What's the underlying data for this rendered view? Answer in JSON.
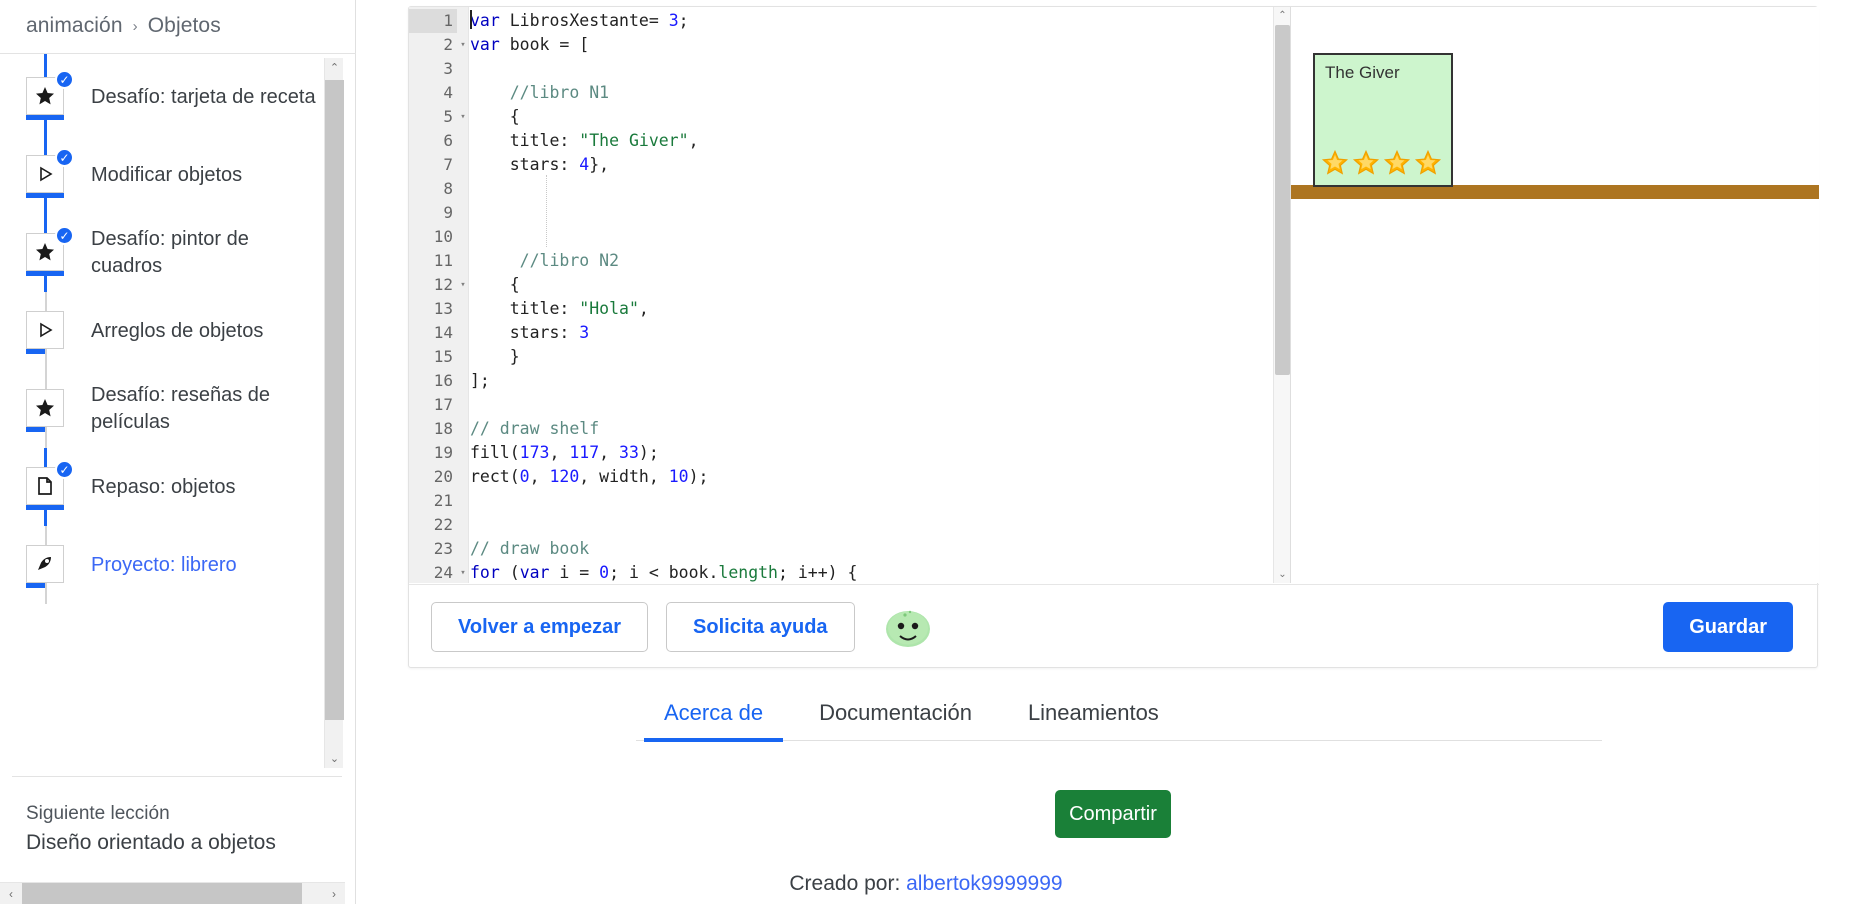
{
  "breadcrumb": {
    "parent": "animación",
    "separator": "›",
    "current": "Objetos"
  },
  "sidebar": {
    "items": [
      {
        "label": "Desafío: tarjeta de receta",
        "icon": "star-icon",
        "completed": true,
        "current": false
      },
      {
        "label": "Modificar objetos",
        "icon": "play-icon",
        "completed": true,
        "current": false
      },
      {
        "label": "Desafío: pintor de cuadros",
        "icon": "star-icon",
        "completed": true,
        "current": false
      },
      {
        "label": "Arreglos de objetos",
        "icon": "play-icon",
        "completed": false,
        "current": false
      },
      {
        "label": "Desafío: reseñas de películas",
        "icon": "star-icon",
        "completed": false,
        "current": false
      },
      {
        "label": "Repaso: objetos",
        "icon": "document-icon",
        "completed": true,
        "current": false
      },
      {
        "label": "Proyecto: librero",
        "icon": "rocket-icon",
        "completed": false,
        "current": true
      }
    ],
    "next_lesson_label": "Siguiente lección",
    "next_lesson_title": "Diseño orientado a objetos"
  },
  "editor": {
    "active_line": 1,
    "lines": [
      {
        "n": 1,
        "fold": false,
        "tokens": [
          {
            "t": "var",
            "c": "kw"
          },
          {
            "t": " LibrosXestante= ",
            "c": "pln"
          },
          {
            "t": "3",
            "c": "num"
          },
          {
            "t": ";",
            "c": "pln"
          }
        ]
      },
      {
        "n": 2,
        "fold": true,
        "tokens": [
          {
            "t": "var",
            "c": "kw"
          },
          {
            "t": " book = [",
            "c": "pln"
          }
        ]
      },
      {
        "n": 3,
        "fold": false,
        "tokens": []
      },
      {
        "n": 4,
        "fold": false,
        "tokens": [
          {
            "t": "    //libro N1",
            "c": "com"
          }
        ]
      },
      {
        "n": 5,
        "fold": true,
        "tokens": [
          {
            "t": "    {",
            "c": "pln"
          }
        ]
      },
      {
        "n": 6,
        "fold": false,
        "tokens": [
          {
            "t": "    title: ",
            "c": "pln"
          },
          {
            "t": "\"The Giver\"",
            "c": "str"
          },
          {
            "t": ",",
            "c": "pln"
          }
        ]
      },
      {
        "n": 7,
        "fold": false,
        "tokens": [
          {
            "t": "    stars: ",
            "c": "pln"
          },
          {
            "t": "4",
            "c": "num"
          },
          {
            "t": "},",
            "c": "pln"
          }
        ]
      },
      {
        "n": 8,
        "fold": false,
        "tokens": []
      },
      {
        "n": 9,
        "fold": false,
        "tokens": []
      },
      {
        "n": 10,
        "fold": false,
        "tokens": []
      },
      {
        "n": 11,
        "fold": false,
        "tokens": [
          {
            "t": "     //libro N2",
            "c": "com"
          }
        ]
      },
      {
        "n": 12,
        "fold": true,
        "tokens": [
          {
            "t": "    {",
            "c": "pln"
          }
        ]
      },
      {
        "n": 13,
        "fold": false,
        "tokens": [
          {
            "t": "    title: ",
            "c": "pln"
          },
          {
            "t": "\"Hola\"",
            "c": "str"
          },
          {
            "t": ",",
            "c": "pln"
          }
        ]
      },
      {
        "n": 14,
        "fold": false,
        "tokens": [
          {
            "t": "    stars: ",
            "c": "pln"
          },
          {
            "t": "3",
            "c": "num"
          }
        ]
      },
      {
        "n": 15,
        "fold": false,
        "tokens": [
          {
            "t": "    }",
            "c": "pln"
          }
        ]
      },
      {
        "n": 16,
        "fold": false,
        "tokens": [
          {
            "t": "];",
            "c": "pln"
          }
        ]
      },
      {
        "n": 17,
        "fold": false,
        "tokens": []
      },
      {
        "n": 18,
        "fold": false,
        "tokens": [
          {
            "t": "// draw shelf",
            "c": "com"
          }
        ]
      },
      {
        "n": 19,
        "fold": false,
        "tokens": [
          {
            "t": "fill(",
            "c": "pln"
          },
          {
            "t": "173",
            "c": "num"
          },
          {
            "t": ", ",
            "c": "pln"
          },
          {
            "t": "117",
            "c": "num"
          },
          {
            "t": ", ",
            "c": "pln"
          },
          {
            "t": "33",
            "c": "num"
          },
          {
            "t": ");",
            "c": "pln"
          }
        ]
      },
      {
        "n": 20,
        "fold": false,
        "tokens": [
          {
            "t": "rect(",
            "c": "pln"
          },
          {
            "t": "0",
            "c": "num"
          },
          {
            "t": ", ",
            "c": "pln"
          },
          {
            "t": "120",
            "c": "num"
          },
          {
            "t": ", width, ",
            "c": "pln"
          },
          {
            "t": "10",
            "c": "num"
          },
          {
            "t": ");",
            "c": "pln"
          }
        ]
      },
      {
        "n": 21,
        "fold": false,
        "tokens": []
      },
      {
        "n": 22,
        "fold": false,
        "tokens": []
      },
      {
        "n": 23,
        "fold": false,
        "tokens": [
          {
            "t": "// draw book",
            "c": "com"
          }
        ]
      },
      {
        "n": 24,
        "fold": true,
        "tokens": [
          {
            "t": "for",
            "c": "kw"
          },
          {
            "t": " (",
            "c": "pln"
          },
          {
            "t": "var",
            "c": "kw"
          },
          {
            "t": " i = ",
            "c": "pln"
          },
          {
            "t": "0",
            "c": "num"
          },
          {
            "t": "; i < book.",
            "c": "pln"
          },
          {
            "t": "length",
            "c": "prop"
          },
          {
            "t": "; i++) {",
            "c": "pln"
          }
        ]
      }
    ]
  },
  "canvas": {
    "book_title": "The Giver",
    "star_count": 4,
    "book_color": "#cdf5cd",
    "shelf_color": "#ad7521",
    "star_color": "#ffb400"
  },
  "actions": {
    "restart_label": "Volver a empezar",
    "help_label": "Solicita ayuda",
    "mascot": "oh-noes-mascot-icon",
    "save_label": "Guardar"
  },
  "footer": {
    "tabs": [
      {
        "label": "Acerca de",
        "active": true
      },
      {
        "label": "Documentación",
        "active": false
      },
      {
        "label": "Lineamientos",
        "active": false
      }
    ],
    "share_label": "Compartir",
    "created_by_prefix": "Creado por: ",
    "author": "albertok9999999"
  },
  "colors": {
    "accent_blue": "#1865f2",
    "link_blue": "#3b68f5",
    "green": "#1a8038"
  }
}
